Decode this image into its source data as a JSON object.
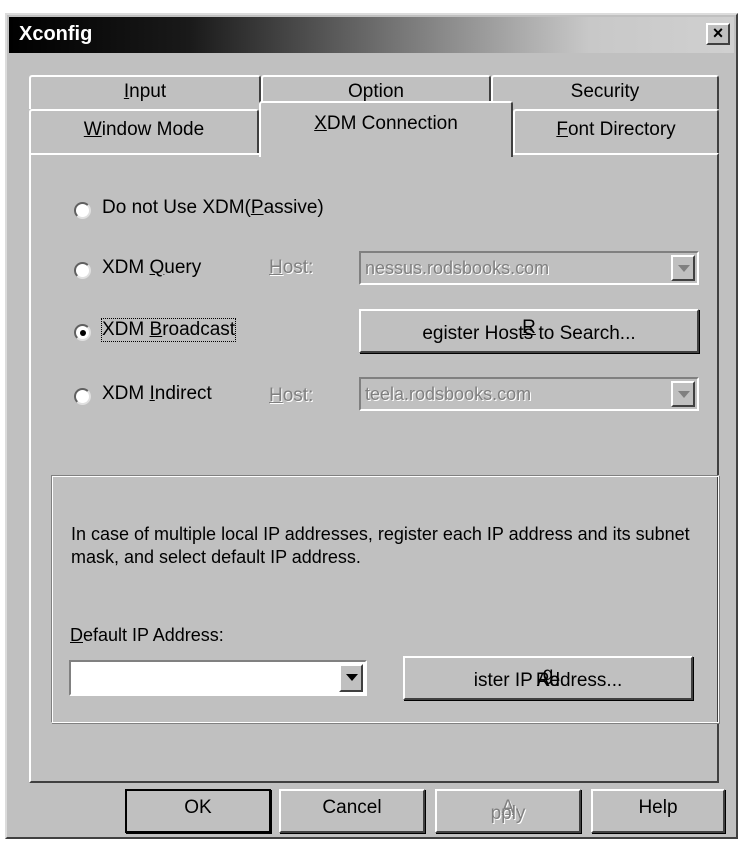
{
  "window": {
    "title": "Xconfig",
    "close_glyph": "×"
  },
  "tabs": {
    "row1": [
      {
        "label": "Input",
        "u": "I"
      },
      {
        "label": "Option",
        "u": ""
      },
      {
        "label": "Security",
        "u": ""
      }
    ],
    "row2": [
      {
        "label": "Window Mode",
        "u": "W"
      },
      {
        "label": "XDM Connection",
        "u": "X",
        "active": true
      },
      {
        "label": "Font Directory",
        "u": "F"
      }
    ]
  },
  "options": {
    "passive": {
      "label_a": "Do not Use XDM(",
      "label_u": "P",
      "label_b": "assive)",
      "selected": false
    },
    "query": {
      "label_a": "XDM ",
      "label_u": "Q",
      "label_b": "uery",
      "host_u": "H",
      "host_b": "ost:",
      "host_value": "nessus.rodsbooks.com",
      "selected": false
    },
    "broadcast": {
      "label_a": "XDM ",
      "label_u": "B",
      "label_b": "roadcast",
      "button_u": "R",
      "button_b": "egister Hosts to Search...",
      "selected": true
    },
    "indirect": {
      "label_a": "XDM ",
      "label_u": "I",
      "label_b": "ndirect",
      "host_u": "H",
      "host_b": "ost:",
      "host_value": "teela.rodsbooks.com",
      "selected": false
    }
  },
  "ip_group": {
    "note": "In case of multiple local IP addresses, register each IP address and its subnet mask, and select default IP address.",
    "default_label_u": "D",
    "default_label_b": "efault IP Address:",
    "default_value": "",
    "register_a": "Re",
    "register_u": "g",
    "register_b": "ister IP Address..."
  },
  "footer": {
    "ok": "OK",
    "cancel": "Cancel",
    "apply_u": "A",
    "apply_b": "pply",
    "help": "Help"
  },
  "colors": {
    "face": "#c0c0c0",
    "shadow": "#808080",
    "highlight": "#ffffff",
    "disabled_text": "#808080"
  }
}
